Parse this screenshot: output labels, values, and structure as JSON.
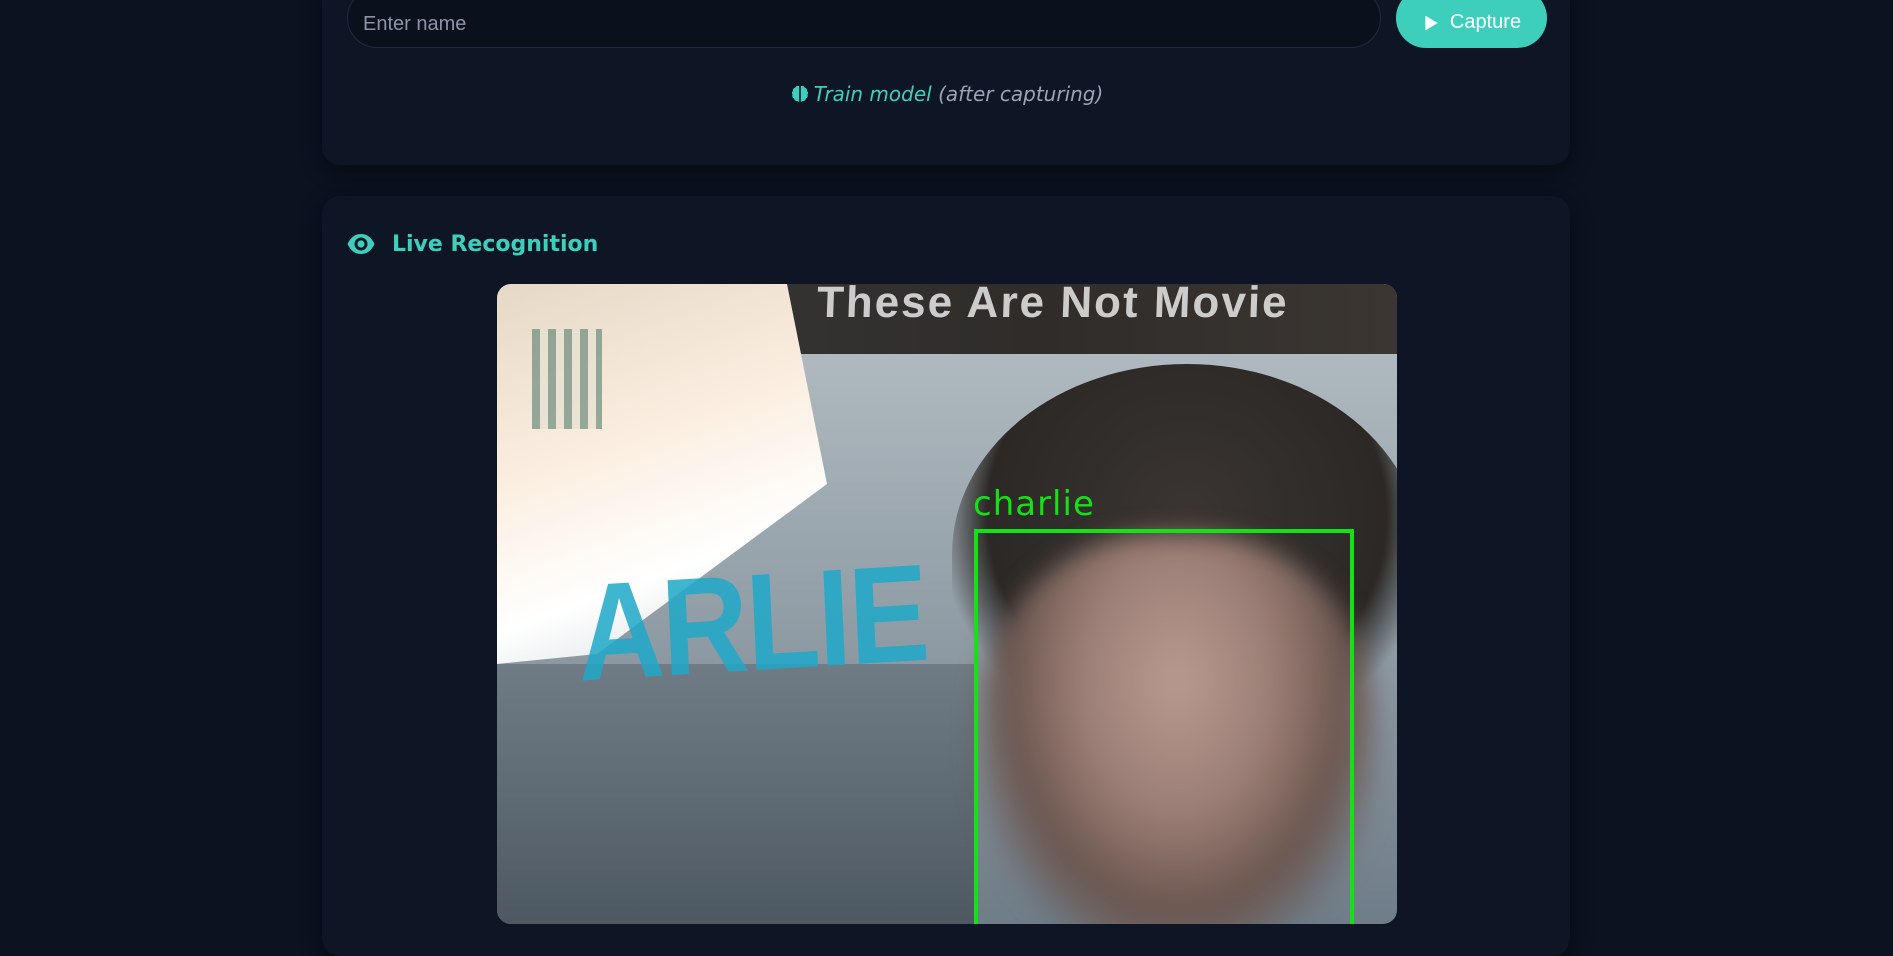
{
  "enroll": {
    "name_input_placeholder": "Enter name",
    "name_input_value": "",
    "capture_label": "Capture",
    "capture_icon": "play-icon",
    "train_link_label": "Train model",
    "train_icon": "brain-icon",
    "train_note": "(after capturing)"
  },
  "live": {
    "title": "Live Recognition",
    "title_icon": "eye-icon",
    "video_banner_text": "These Are Not Movie",
    "video_shirt_text": "ARLIE",
    "detection_label": "charlie",
    "detection_color": "#16e016"
  },
  "colors": {
    "background": "#0b1220",
    "card": "#0e1626",
    "accent": "#3ecfbc"
  }
}
